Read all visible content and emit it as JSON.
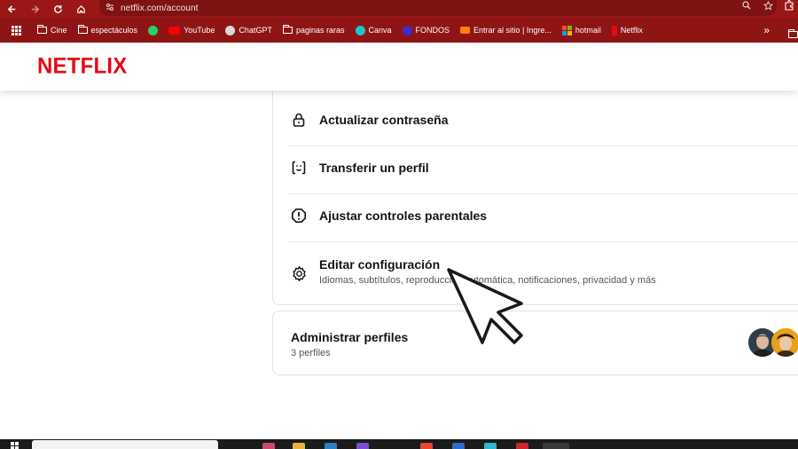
{
  "browser": {
    "url": "netflix.com/account"
  },
  "bookmarks": [
    {
      "label": "Cine",
      "icon": "folder-icon"
    },
    {
      "label": "espectáculos",
      "icon": "folder-icon"
    },
    {
      "label": "",
      "icon": "whatsapp-icon",
      "color": "#25d366"
    },
    {
      "label": "YouTube",
      "icon": "youtube-icon",
      "color": "#ff0000"
    },
    {
      "label": "ChatGPT",
      "icon": "chatgpt-icon",
      "color": "#d9d9d9"
    },
    {
      "label": "paginas raras",
      "icon": "folder-icon"
    },
    {
      "label": "Canva",
      "icon": "canva-icon",
      "color": "#20c4cb"
    },
    {
      "label": "FONDOS",
      "icon": "fondos-icon",
      "color": "#3a2ccf"
    },
    {
      "label": "Entrar al sitio | Ingre...",
      "icon": "moodle-icon",
      "color": "#f98012"
    },
    {
      "label": "hotmail",
      "icon": "microsoft-icon",
      "color": "#f25022"
    },
    {
      "label": "Netflix",
      "icon": "netflix-icon",
      "color": "#e50914"
    }
  ],
  "header": {
    "logo": "NETFLIX"
  },
  "settings": {
    "items": [
      {
        "label": "Actualizar contraseña",
        "icon": "lock-icon"
      },
      {
        "label": "Transferir un perfil",
        "icon": "transfer-profile-icon"
      },
      {
        "label": "Ajustar controles parentales",
        "icon": "alert-octagon-icon"
      },
      {
        "label": "Editar configuración",
        "sub": "Idiomas, subtítulos, reproducción automática, notificaciones, privacidad y más",
        "icon": "gear-icon"
      }
    ]
  },
  "profiles": {
    "title": "Administrar perfiles",
    "count": "3 perfiles"
  },
  "colors": {
    "brand": "#e50914",
    "browser_frame": "#9a1717",
    "bookmarks_bar": "#8f1515"
  }
}
